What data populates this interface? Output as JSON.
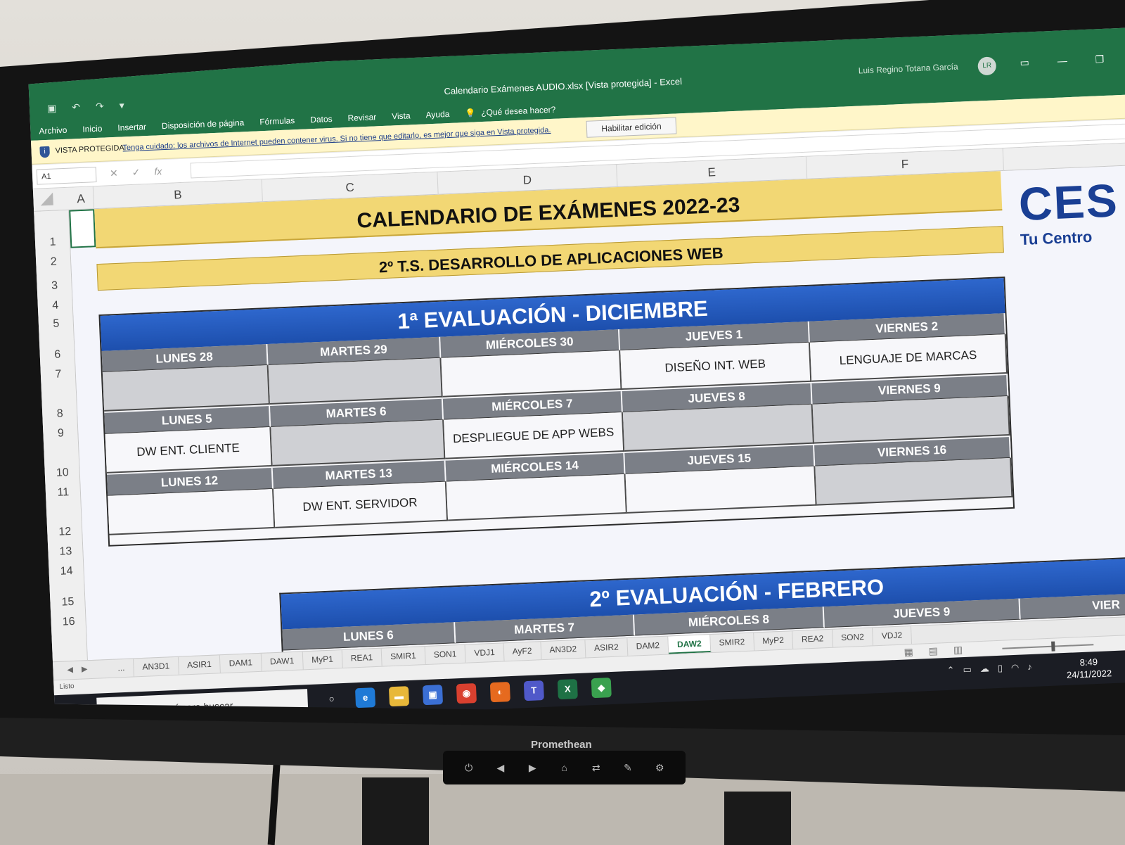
{
  "window": {
    "title": "Calendario Exámenes AUDIO.xlsx  [Vista protegida]  -  Excel",
    "user_name": "Luis Regino Totana García",
    "user_initials": "LR"
  },
  "menu": [
    "Archivo",
    "Inicio",
    "Insertar",
    "Disposición de página",
    "Fórmulas",
    "Datos",
    "Revisar",
    "Vista",
    "Ayuda"
  ],
  "tell_me": "¿Qué desea hacer?",
  "protected_view": {
    "label": "VISTA PROTEGIDA",
    "message": "Tenga cuidado: los archivos de Internet pueden contener virus. Si no tiene que editarlo, es mejor que siga en Vista protegida.",
    "enable_button": "Habilitar edición"
  },
  "name_box": "A1",
  "columns": [
    "A",
    "B",
    "C",
    "D",
    "E",
    "F"
  ],
  "rows": [
    "1",
    "2",
    "3",
    "4",
    "5",
    "6",
    "7",
    "8",
    "9",
    "10",
    "11",
    "12",
    "13",
    "14",
    "15",
    "16"
  ],
  "sheet": {
    "title": "CALENDARIO DE EXÁMENES 2022-23",
    "subtitle": "2º T.S. DESARROLLO DE APLICACIONES WEB",
    "logo_text": "CES",
    "logo_subtext": "Tu Centro"
  },
  "eval1": {
    "title": "1ª EVALUACIÓN - DICIEMBRE",
    "weeks": [
      {
        "days": [
          "LUNES 28",
          "MARTES 29",
          "MIÉRCOLES 30",
          "JUEVES 1",
          "VIERNES 2"
        ],
        "exams": [
          "",
          "",
          "",
          "DISEÑO INT. WEB",
          "LENGUAJE DE MARCAS"
        ]
      },
      {
        "days": [
          "LUNES 5",
          "MARTES 6",
          "MIÉRCOLES 7",
          "JUEVES 8",
          "VIERNES 9"
        ],
        "exams": [
          "DW ENT. CLIENTE",
          "",
          "DESPLIEGUE DE APP WEBS",
          "",
          ""
        ]
      },
      {
        "days": [
          "LUNES 12",
          "MARTES 13",
          "MIÉRCOLES 14",
          "JUEVES 15",
          "VIERNES 16"
        ],
        "exams": [
          "",
          "DW ENT. SERVIDOR",
          "",
          "",
          ""
        ]
      }
    ]
  },
  "eval2": {
    "title": "2º EVALUACIÓN - FEBRERO",
    "days": [
      "LUNES 6",
      "MARTES 7",
      "MIÉRCOLES 8",
      "JUEVES 9",
      "VIER"
    ]
  },
  "sheet_tabs": [
    "...",
    "AN3D1",
    "ASIR1",
    "DAM1",
    "DAW1",
    "MyP1",
    "REA1",
    "SMIR1",
    "SON1",
    "VDJ1",
    "AyF2",
    "AN3D2",
    "ASIR2",
    "DAM2",
    "DAW2",
    "SMIR2",
    "MyP2",
    "REA2",
    "SON2",
    "VDJ2"
  ],
  "active_tab": "DAW2",
  "status": "Listo",
  "taskbar": {
    "search_placeholder": "Escribe aquí para buscar",
    "time": "8:49",
    "date": "24/11/2022"
  },
  "monitor_brand": "Promethean",
  "colors": {
    "excel_green": "#217346",
    "title_band": "#f2d774",
    "eval_header": "#2e67cd",
    "day_header": "#7b7f87"
  }
}
